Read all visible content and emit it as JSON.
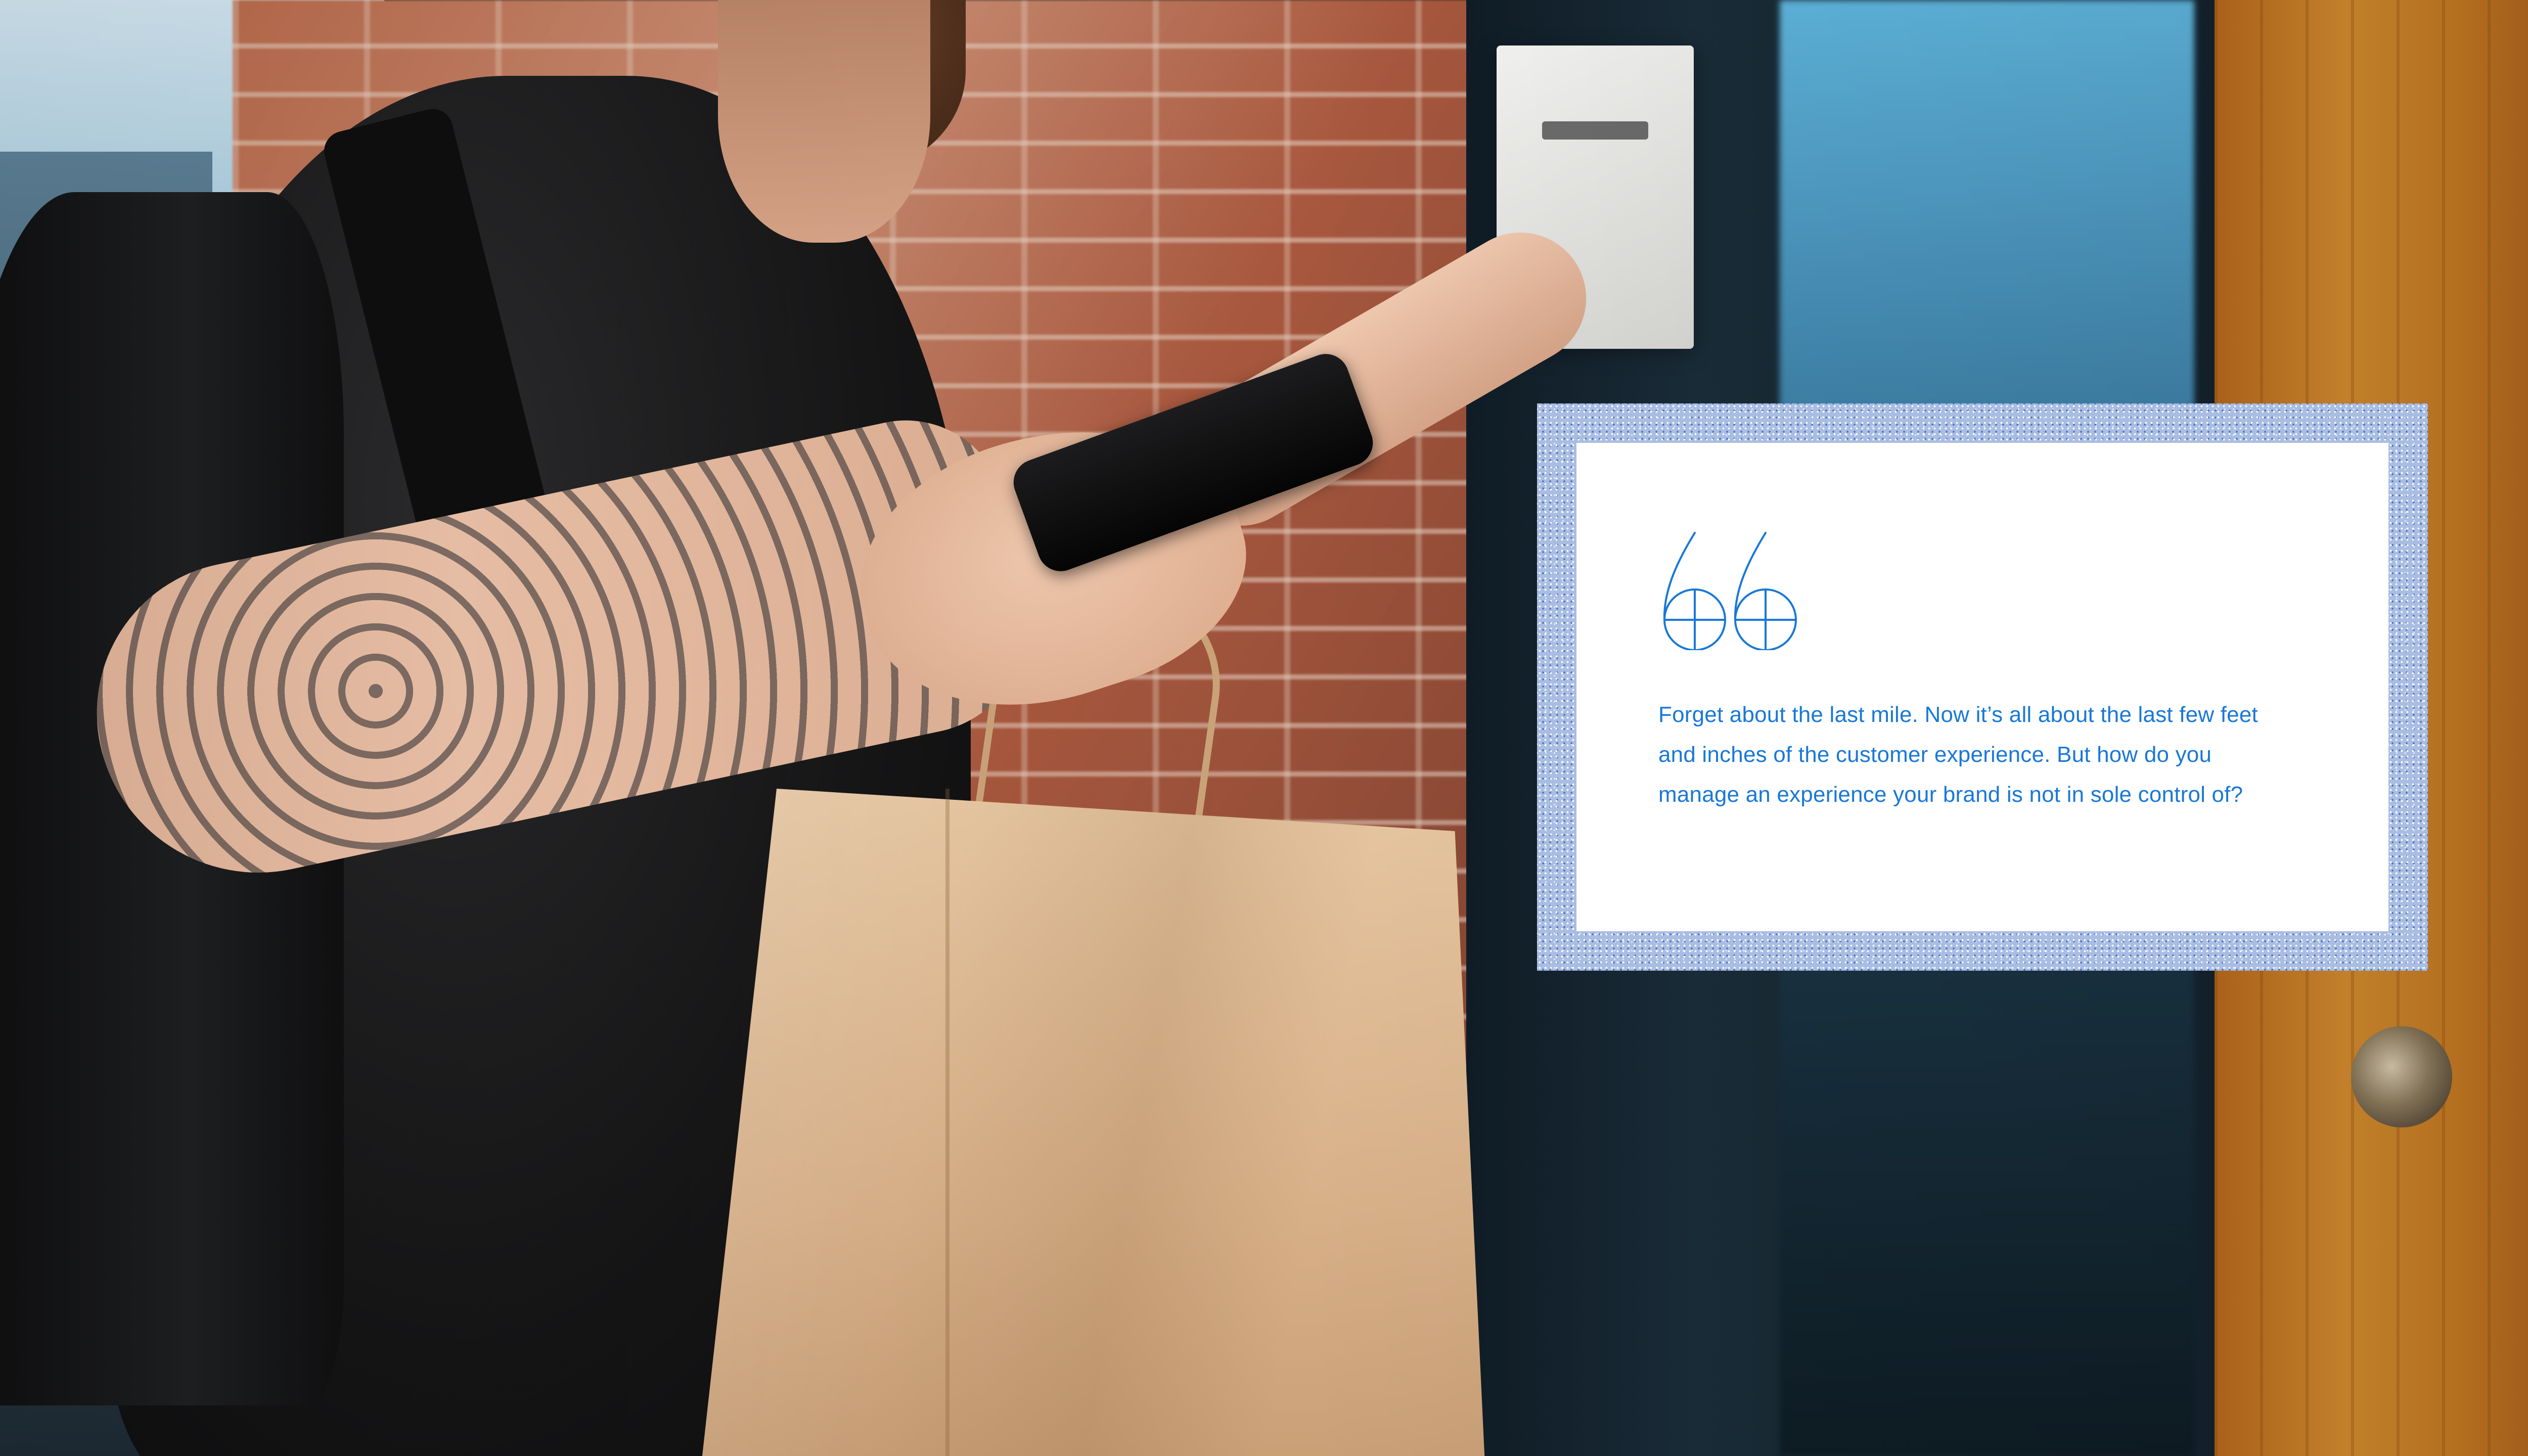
{
  "quote": {
    "text": "Forget about the last mile. Now it’s all about the last few feet and inches of the customer experience. But how do you manage an experience your brand is not in sole control of?",
    "mark_icon": "opening-quote-mark-icon",
    "text_color": "#1878D8",
    "frame_color": "#A9BDE2"
  },
  "background": {
    "scene": "delivery-person-at-door-photo",
    "icons": [
      "smartphone",
      "paper-bag",
      "intercom",
      "door-knob"
    ]
  }
}
